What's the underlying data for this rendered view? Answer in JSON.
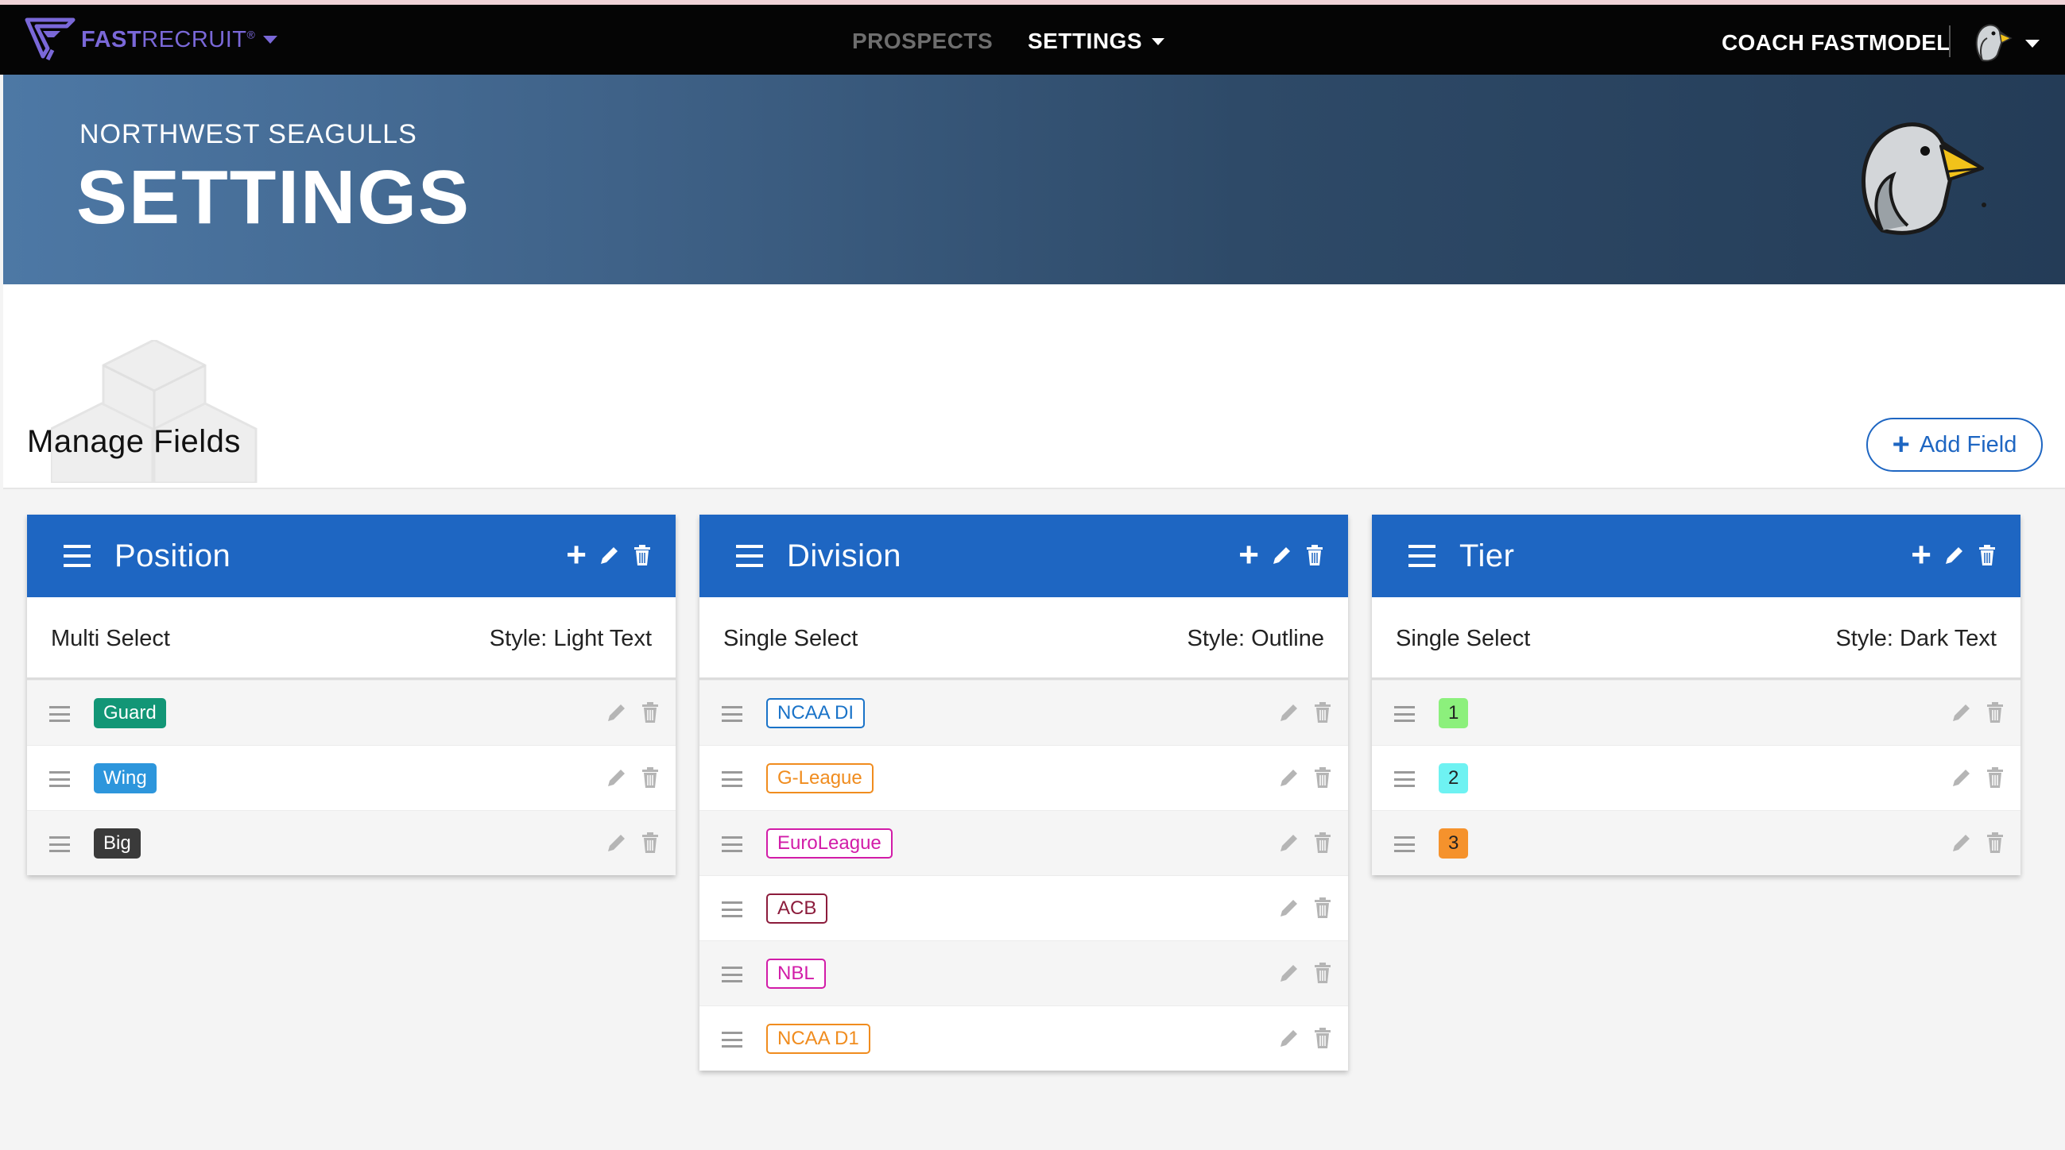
{
  "navbar": {
    "brand_bold": "FAST",
    "brand_light": "RECRUIT",
    "brand_mark": "®",
    "nav_prospects": "PROSPECTS",
    "nav_settings": "SETTINGS",
    "user_name": "COACH FASTMODEL",
    "brand_color": "#7a68d8"
  },
  "hero": {
    "team": "NORTHWEST SEAGULLS",
    "title": "SETTINGS"
  },
  "manage": {
    "title": "Manage Fields",
    "add_field_label": "Add Field",
    "accent": "#1e66c2"
  },
  "cards": [
    {
      "title": "Position",
      "type": "Multi Select",
      "style_label": "Style:",
      "style_value": "Light Text",
      "values": [
        {
          "label": "Guard",
          "color": "#129676"
        },
        {
          "label": "Wing",
          "color": "#2d96dc"
        },
        {
          "label": "Big",
          "color": "#3a3a3a"
        }
      ]
    },
    {
      "title": "Division",
      "type": "Single Select",
      "style_label": "Style:",
      "style_value": "Outline",
      "values": [
        {
          "label": "NCAA DI",
          "color": "#1a73c8"
        },
        {
          "label": "G-League",
          "color": "#f08c1e"
        },
        {
          "label": "EuroLeague",
          "color": "#d21ca8"
        },
        {
          "label": "ACB",
          "color": "#8c1c3c"
        },
        {
          "label": "NBL",
          "color": "#d21ca8"
        },
        {
          "label": "NCAA D1",
          "color": "#f08c1e"
        }
      ]
    },
    {
      "title": "Tier",
      "type": "Single Select",
      "style_label": "Style:",
      "style_value": "Dark Text",
      "values": [
        {
          "label": "1",
          "color": "#8cf07c"
        },
        {
          "label": "2",
          "color": "#6ef2f2"
        },
        {
          "label": "3",
          "color": "#f5922c"
        }
      ]
    }
  ]
}
